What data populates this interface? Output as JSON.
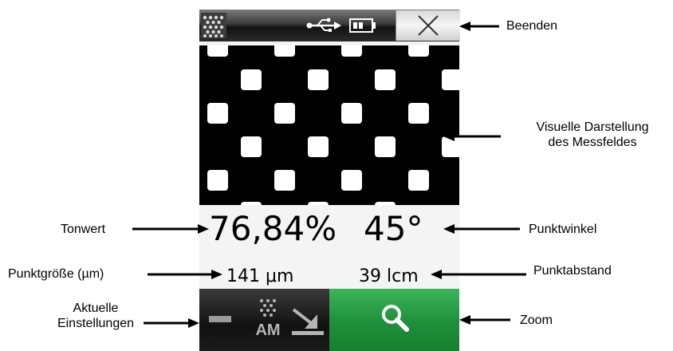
{
  "screen": {
    "tonwert_value": "76,84%",
    "winkel_value": "45°",
    "punktgroesse_value": "141 μm",
    "punktabstand_value": "39 lcm",
    "am_label": "AM"
  },
  "annotations": {
    "beenden": "Beenden",
    "visuelle_line1": "Visuelle Darstellung",
    "visuelle_line2": "des Messfeldes",
    "tonwert": "Tonwert",
    "punktwinkel": "Punktwinkel",
    "punktgroesse": "Punktgröße (µm)",
    "punktabstand": "Punktabstand",
    "aktuelle_line1": "Aktuelle",
    "aktuelle_line2": "Einstellungen",
    "zoom": "Zoom"
  },
  "colors": {
    "zoom_green": "#1f8f3a",
    "bar_dark": "#121212",
    "icon_gray": "#b5b5b5"
  },
  "icons": [
    "menu-dots-icon",
    "usb-icon",
    "battery-icon",
    "close-icon",
    "minus-icon",
    "am-screening-icon",
    "arrow-down-right-icon",
    "magnifier-icon"
  ]
}
